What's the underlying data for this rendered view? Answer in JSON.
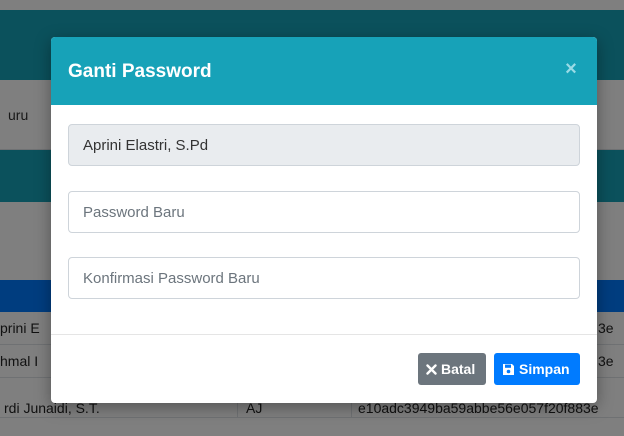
{
  "background": {
    "nav_text": "uru",
    "rows": [
      {
        "name": "prini E",
        "code": "",
        "hash": "3e"
      },
      {
        "name": "hmal I",
        "code": "",
        "hash": "3e"
      },
      {
        "name": "rdi Junaidi, S.T.",
        "code": "AJ",
        "hash": "e10adc3949ba59abbe56e057f20f883e"
      }
    ]
  },
  "modal": {
    "title": "Ganti Password",
    "close_label": "×",
    "name_value": "Aprini Elastri, S.Pd",
    "new_password_placeholder": "Password Baru",
    "confirm_password_placeholder": "Konfirmasi Password Baru",
    "cancel_label": "Batal",
    "save_label": "Simpan"
  },
  "colors": {
    "header": "#17a2b8",
    "primary": "#007bff",
    "secondary": "#6c757d"
  }
}
